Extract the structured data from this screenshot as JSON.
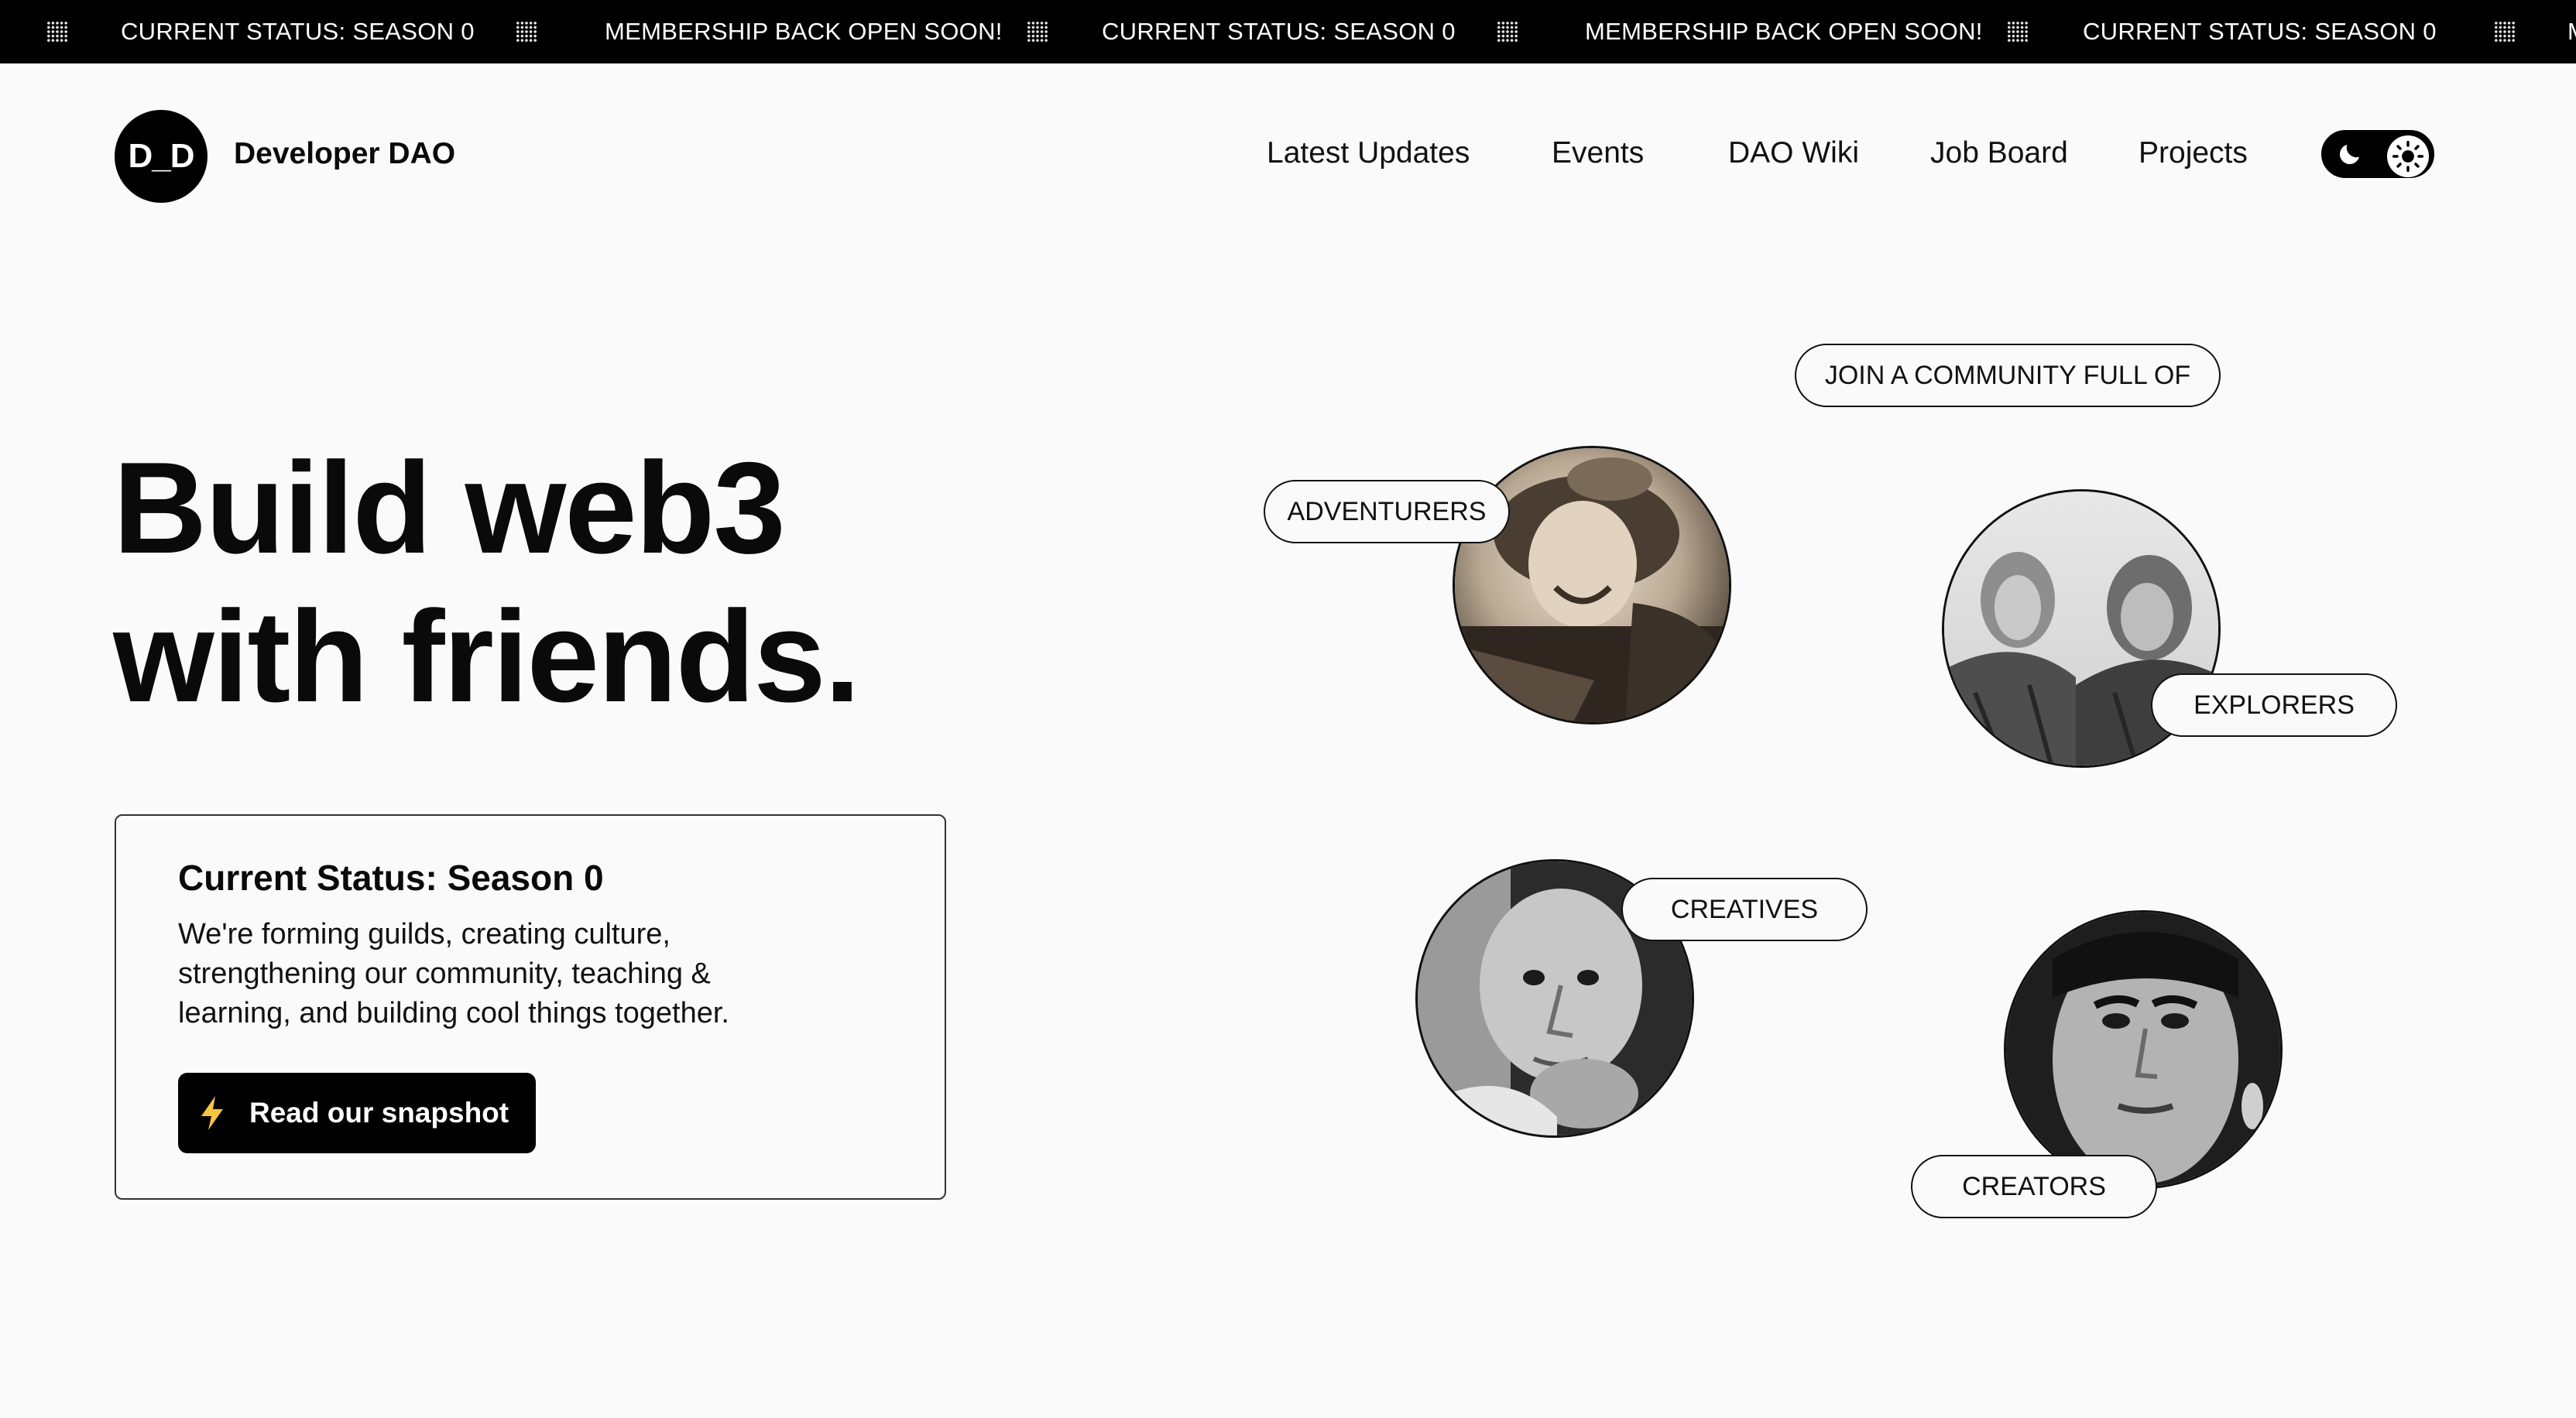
{
  "ticker": {
    "items": [
      "CURRENT STATUS: SEASON 0",
      "MEMBERSHIP BACK OPEN SOON!",
      "CURRENT STATUS: SEASON 0",
      "MEMBERSHIP BACK OPEN SOON!",
      "CURRENT STATUS: SEASON 0",
      "M"
    ],
    "icon": "dotted-grid-icon"
  },
  "header": {
    "logo_text": "D_D",
    "brand": "Developer DAO",
    "nav": [
      "Latest Updates",
      "Events",
      "DAO Wiki",
      "Job Board",
      "Projects"
    ],
    "theme_toggle": {
      "icons": [
        "moon-icon",
        "sun-icon"
      ],
      "active": "light"
    }
  },
  "hero": {
    "title_line1": "Build web3",
    "title_line2": "with friends."
  },
  "status_card": {
    "title": "Current Status: Season 0",
    "body": "We're forming guilds, creating culture, strengthening our community, teaching & learning, and building cool things together.",
    "button_label": "Read our snapshot",
    "button_icon": "lightning-bolt-icon",
    "accent": "#f5c542"
  },
  "community": {
    "heading": "JOIN A COMMUNITY FULL OF",
    "groups": [
      {
        "label": "ADVENTURERS",
        "photo": "aviator-portrait"
      },
      {
        "label": "EXPLORERS",
        "photo": "mountaineers-portrait"
      },
      {
        "label": "CREATIVES",
        "photo": "painter-portrait"
      },
      {
        "label": "CREATORS",
        "photo": "artist-portrait"
      }
    ]
  },
  "colors": {
    "background": "#fafafa",
    "ticker_bg": "#000000",
    "text": "#0a0a0a"
  }
}
